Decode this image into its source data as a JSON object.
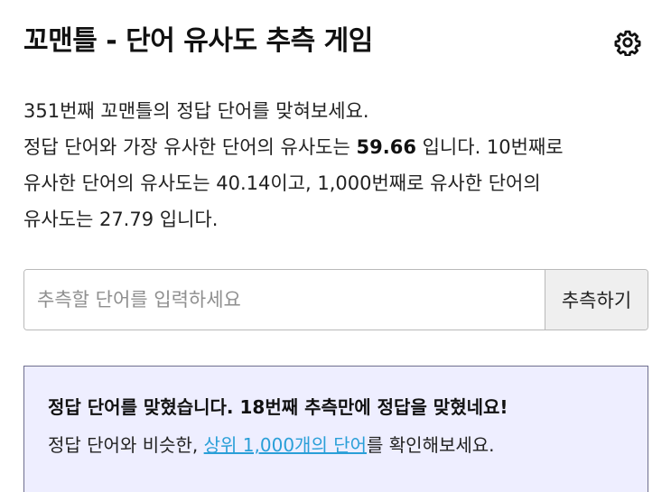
{
  "header": {
    "title": "꼬맨틀 - 단어 유사도 추측 게임",
    "settings_icon": "gear-icon"
  },
  "intro": {
    "line1": "351번째 꼬맨틀의 정답 단어를 맞혀보세요.",
    "line2_prefix": "정답 단어와 가장 유사한 단어의 유사도는 ",
    "top_similarity": "59.66",
    "line2_suffix": " 입니다. 10번째로",
    "line3": "유사한 단어의 유사도는 40.14이고, 1,000번째로 유사한 단어의",
    "line4": "유사도는 27.79 입니다."
  },
  "guess": {
    "placeholder": "추측할 단어를 입력하세요",
    "value": "",
    "button_label": "추측하기"
  },
  "result": {
    "headline": "정답 단어를 맞혔습니다. 18번째 추측만에 정답을 맞혔네요!",
    "body_prefix": "정답 단어와 비슷한, ",
    "link_label": "상위 1,000개의 단어",
    "body_suffix": "를 확인해보세요."
  },
  "colors": {
    "result_bg": "#eeeeff",
    "result_border": "#6f6f8f",
    "link": "#2a9fd8",
    "button_bg": "#efefef"
  }
}
